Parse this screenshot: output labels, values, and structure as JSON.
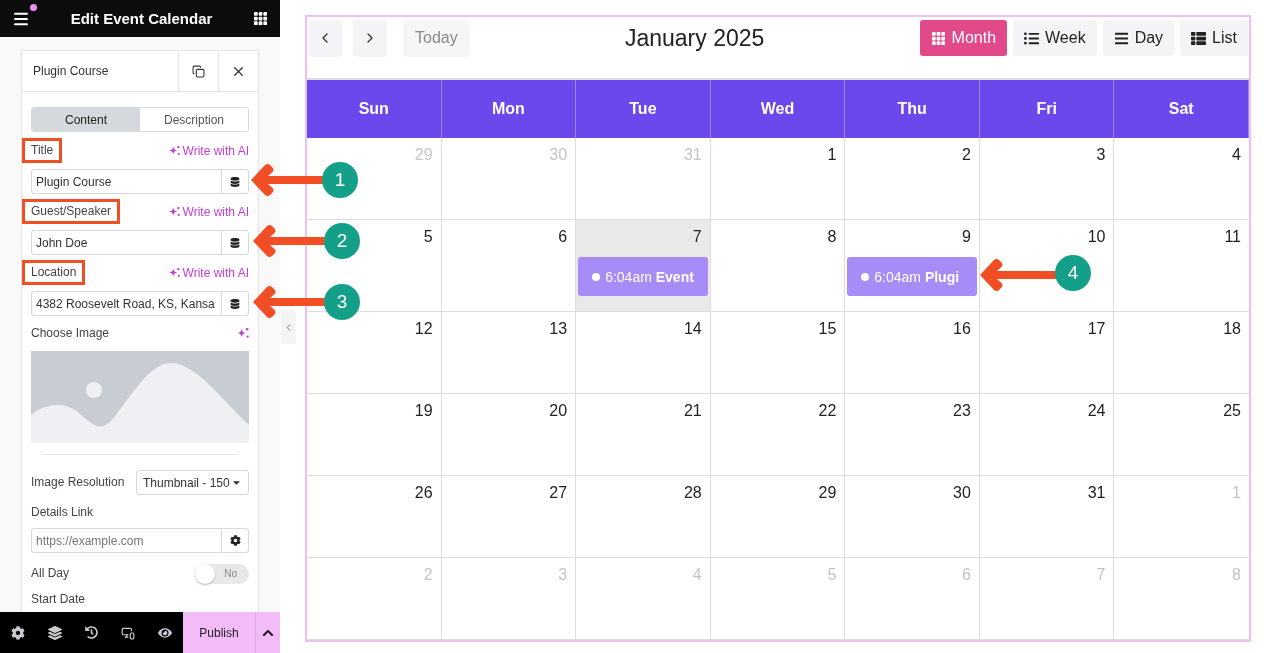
{
  "editor": {
    "title": "Edit Event Calendar"
  },
  "item": {
    "title": "Plugin Course"
  },
  "tabs": [
    {
      "label": "Content",
      "selected": true
    },
    {
      "label": "Description",
      "selected": false
    }
  ],
  "fields": [
    {
      "kind": "text",
      "label": "Title",
      "highlighted": true,
      "ai_action": "Write with AI",
      "value": "Plugin Course"
    },
    {
      "kind": "text",
      "label": "Guest/Speaker",
      "highlighted": true,
      "ai_action": "Write with AI",
      "value": "John Doe"
    },
    {
      "kind": "text",
      "label": "Location",
      "highlighted": true,
      "ai_action": "Write with AI",
      "value": "4382 Roosevelt Road, KS, Kansa"
    },
    {
      "kind": "image",
      "label": "Choose Image",
      "highlighted": false
    },
    {
      "kind": "select",
      "label": "Image Resolution",
      "highlighted": false,
      "value": "Thumbnail - 150"
    },
    {
      "kind": "link",
      "label": "Details Link",
      "highlighted": false,
      "placeholder": "https://example.com"
    },
    {
      "kind": "toggle",
      "label": "All Day",
      "highlighted": false,
      "on": false,
      "state_label": "No"
    },
    {
      "kind": "heading",
      "label": "Start Date",
      "highlighted": false
    }
  ],
  "bottom_bar": {
    "publish": "Publish"
  },
  "calendar": {
    "title": "January 2025",
    "today_button": {
      "label": "Today",
      "disabled": true
    },
    "views": [
      {
        "label": "Month",
        "selected": true
      },
      {
        "label": "Week",
        "selected": false
      },
      {
        "label": "Day",
        "selected": false
      },
      {
        "label": "List",
        "selected": false
      }
    ],
    "weekdays": [
      "Sun",
      "Mon",
      "Tue",
      "Wed",
      "Thu",
      "Fri",
      "Sat"
    ],
    "weeks": [
      [
        {
          "day": "29",
          "outside": true,
          "today": false
        },
        {
          "day": "30",
          "outside": true,
          "today": false
        },
        {
          "day": "31",
          "outside": true,
          "today": false
        },
        {
          "day": "1",
          "outside": false,
          "today": false
        },
        {
          "day": "2",
          "outside": false,
          "today": false
        },
        {
          "day": "3",
          "outside": false,
          "today": false
        },
        {
          "day": "4",
          "outside": false,
          "today": false
        }
      ],
      [
        {
          "day": "5",
          "outside": false,
          "today": false
        },
        {
          "day": "6",
          "outside": false,
          "today": false
        },
        {
          "day": "7",
          "outside": false,
          "today": true,
          "events": [
            {
              "time": "6:04am",
              "title": "Event"
            }
          ]
        },
        {
          "day": "8",
          "outside": false,
          "today": false
        },
        {
          "day": "9",
          "outside": false,
          "today": false,
          "events": [
            {
              "time": "6:04am",
              "title": "Plugi"
            }
          ]
        },
        {
          "day": "10",
          "outside": false,
          "today": false
        },
        {
          "day": "11",
          "outside": false,
          "today": false
        }
      ],
      [
        {
          "day": "12",
          "outside": false,
          "today": false
        },
        {
          "day": "13",
          "outside": false,
          "today": false
        },
        {
          "day": "14",
          "outside": false,
          "today": false
        },
        {
          "day": "15",
          "outside": false,
          "today": false
        },
        {
          "day": "16",
          "outside": false,
          "today": false
        },
        {
          "day": "17",
          "outside": false,
          "today": false
        },
        {
          "day": "18",
          "outside": false,
          "today": false
        }
      ],
      [
        {
          "day": "19",
          "outside": false,
          "today": false
        },
        {
          "day": "20",
          "outside": false,
          "today": false
        },
        {
          "day": "21",
          "outside": false,
          "today": false
        },
        {
          "day": "22",
          "outside": false,
          "today": false
        },
        {
          "day": "23",
          "outside": false,
          "today": false
        },
        {
          "day": "24",
          "outside": false,
          "today": false
        },
        {
          "day": "25",
          "outside": false,
          "today": false
        }
      ],
      [
        {
          "day": "26",
          "outside": false,
          "today": false
        },
        {
          "day": "27",
          "outside": false,
          "today": false
        },
        {
          "day": "28",
          "outside": false,
          "today": false
        },
        {
          "day": "29",
          "outside": false,
          "today": false
        },
        {
          "day": "30",
          "outside": false,
          "today": false
        },
        {
          "day": "31",
          "outside": false,
          "today": false
        },
        {
          "day": "1",
          "outside": true,
          "today": false
        }
      ],
      [
        {
          "day": "2",
          "outside": true,
          "today": false
        },
        {
          "day": "3",
          "outside": true,
          "today": false
        },
        {
          "day": "4",
          "outside": true,
          "today": false
        },
        {
          "day": "5",
          "outside": true,
          "today": false
        },
        {
          "day": "6",
          "outside": true,
          "today": false
        },
        {
          "day": "7",
          "outside": true,
          "today": false
        },
        {
          "day": "8",
          "outside": true,
          "today": false
        }
      ]
    ]
  },
  "callouts": [
    {
      "number": "1"
    },
    {
      "number": "2"
    },
    {
      "number": "3"
    },
    {
      "number": "4"
    }
  ]
}
